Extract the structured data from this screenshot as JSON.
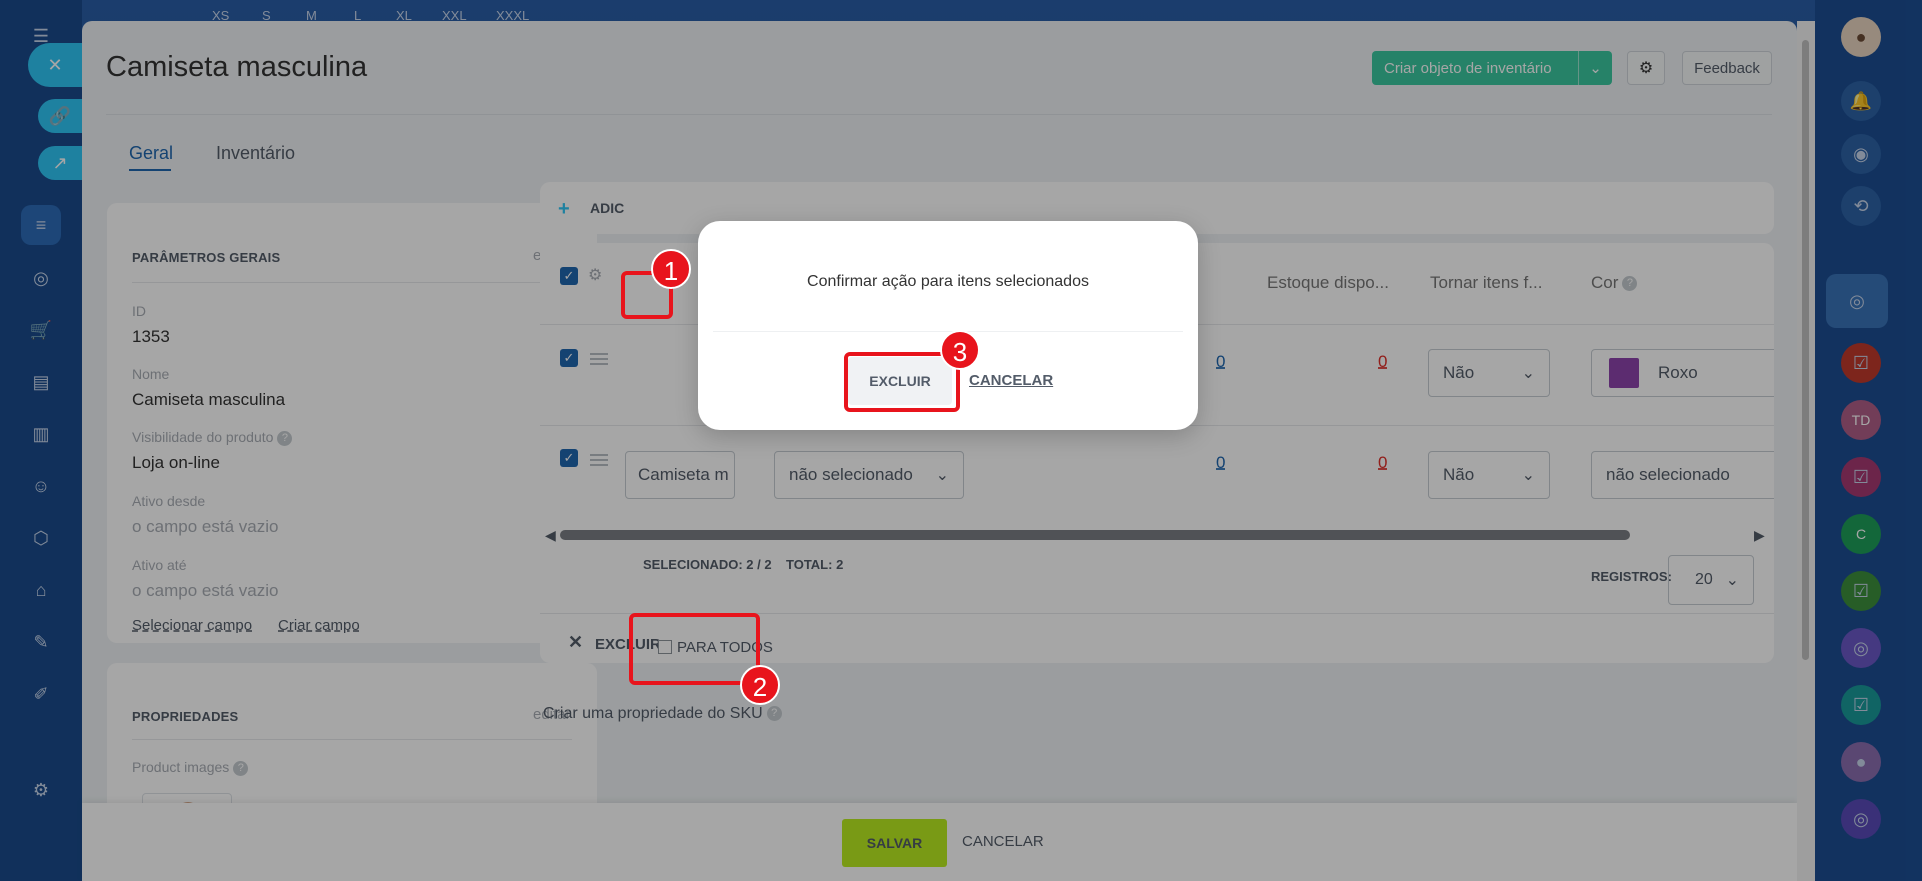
{
  "top_strip_sizes": [
    "XS",
    "S",
    "M",
    "L",
    "XL",
    "XXL",
    "XXXL"
  ],
  "header": {
    "title": "Camiseta masculina",
    "create_inventory": "Criar objeto de inventário",
    "feedback": "Feedback"
  },
  "tabs": [
    {
      "label": "Geral",
      "active": true
    },
    {
      "label": "Inventário",
      "active": false
    }
  ],
  "general_params": {
    "heading": "PARÂMETROS GERAIS",
    "edit": "editar",
    "fields": [
      {
        "label": "ID",
        "value": "1353"
      },
      {
        "label": "Nome",
        "value": "Camiseta masculina"
      },
      {
        "label": "Visibilidade do produto",
        "value": "Loja on-line"
      },
      {
        "label": "Ativo desde",
        "value": "o campo está vazio"
      },
      {
        "label": "Ativo até",
        "value": "o campo está vazio"
      }
    ],
    "select_field": "Selecionar campo",
    "create_field": "Criar campo"
  },
  "properties": {
    "heading": "PROPRIEDADES",
    "edit": "editar",
    "product_images": "Product images"
  },
  "sku_table": {
    "add_label": "ADIC",
    "columns": [
      "Estoque dispo...",
      "Tornar itens f...",
      "Cor"
    ],
    "rows": [
      {
        "stock_blue": "0",
        "stock_red": "0",
        "tornar": "Não",
        "cor": "Roxo",
        "cor_color": "#8e44ad"
      },
      {
        "name": "Camiseta m",
        "size": "não selecionado",
        "stock_blue": "0",
        "stock_red": "0",
        "tornar": "Não",
        "cor": "não selecionado"
      }
    ],
    "selected_label": "SELECIONADO: 2 / 2",
    "total_label": "TOTAL: 2",
    "records_label": "REGISTROS:",
    "records_value": "20",
    "delete_action": "EXCLUIR",
    "for_all": "PARA TODOS",
    "create_sku_prop": "Criar uma propriedade do SKU"
  },
  "bottom": {
    "save": "SALVAR",
    "cancel": "CANCELAR"
  },
  "dialog": {
    "message": "Confirmar ação para itens selecionados",
    "confirm": "EXCLUIR",
    "cancel": "CANCELAR"
  },
  "annotations": [
    "1",
    "2",
    "3"
  ],
  "right_rail_initials": [
    "TD",
    "C"
  ],
  "colors": {
    "accent_blue": "#2067b0",
    "green_button": "#3bc8a0",
    "save_button": "#bbed21",
    "annotation_red": "#e8141c",
    "swatch_purple": "#8e44ad"
  }
}
